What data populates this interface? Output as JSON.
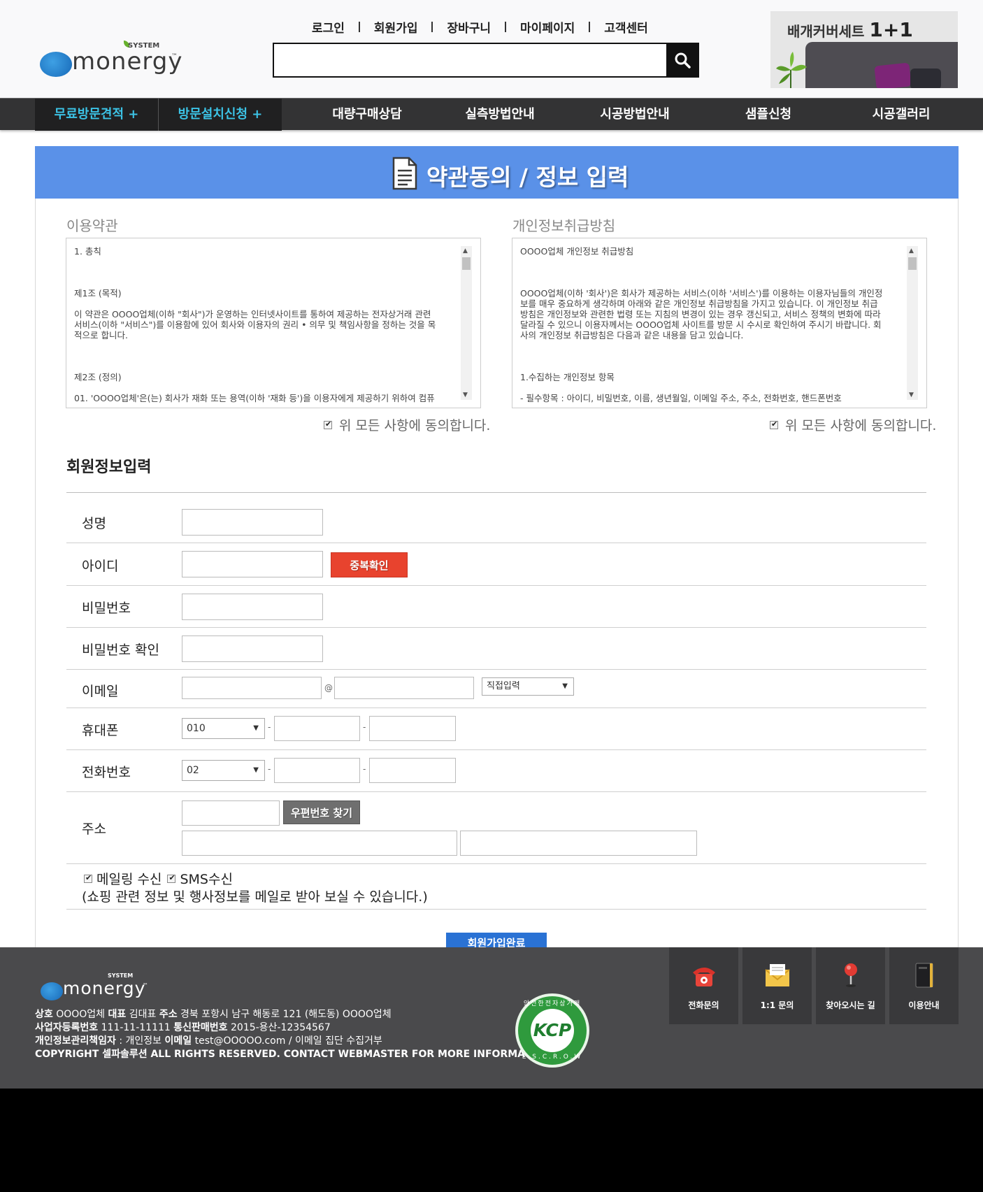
{
  "header": {
    "logo_text": "monergy",
    "logo_system": "SYSTEM",
    "logo_tm": "™",
    "top_links": [
      "로그인",
      "회원가입",
      "장바구니",
      "마이페이지",
      "고객센터"
    ],
    "search_placeholder": "",
    "search_icon": "search-icon",
    "banner": {
      "text": "배개커버세트",
      "highlight": "1+1"
    }
  },
  "main_nav": [
    "무료방문견적 +",
    "방문설치신청 +",
    "대량구매상담",
    "실측방법안내",
    "시공방법안내",
    "샘플신청",
    "시공갤러리"
  ],
  "page_title": "약관동의 / 정보 입력",
  "terms": {
    "label": "이용약관",
    "text": "1. 총칙\n\n\n\n제1조 (목적)\n\n이 약관은 OOOO업체(이하 \"회사\")가 운영하는 인터넷사이트를 통하여 제공하는 전자상거래 관련\n서비스(이하 \"서비스\")를 이용함에 있어 회사와 이용자의 권리 • 의무 및 책임사항을 정하는 것을 목\n적으로 합니다.\n\n\n\n제2조 (정의)\n\n01. 'OOOO업체'은(는) 회사가 재화 또는 용역(이하 '재화 등')을 이용자에게 제공하기 위하여 컴퓨",
    "agree_label": "위 모든 사항에 동의합니다."
  },
  "privacy": {
    "label": "개인정보취급방침",
    "text": "OOOO업체 개인정보 취급방침\n\n\n\nOOOO업체(이하 '회사')은 회사가 제공하는 서비스(이하 '서비스')를 이용하는 이용자님들의 개인정\n보를 매우 중요하게 생각하며 아래와 같은 개인정보 취급방침을 가지고 있습니다. 이 개인정보 취급\n방침은 개인정보와 관련한 법령 또는 지침의 변경이 있는 경우 갱신되고, 서비스 정책의 변화에 따라\n달라질 수 있으니 이용자께서는 OOOO업체 사이트를 방문 시 수시로 확인하여 주시기 바랍니다. 회\n사의 개인정보 취급방침은 다음과 같은 내용을 담고 있습니다.\n\n\n\n1.수집하는 개인정보 항목\n\n- 필수항목 : 아이디, 비밀번호, 이름, 생년월일, 이메일 주소, 주소, 전화번호, 핸드폰번호",
    "agree_label": "위 모든 사항에 동의합니다."
  },
  "form": {
    "section_title": "회원정보입력",
    "name_label": "성명",
    "id_label": "아이디",
    "id_check_button": "중복확인",
    "password_label": "비밀번호",
    "password_confirm_label": "비밀번호 확인",
    "email_label": "이메일",
    "email_at": "@",
    "email_domain_select": "직접입력",
    "mobile_label": "휴대폰",
    "mobile_prefix": "010",
    "phone_label": "전화번호",
    "phone_prefix": "02",
    "dash": "-",
    "address_label": "주소",
    "zipcode_button": "우편번호 찾기",
    "mailing_label": "메일링 수신",
    "sms_label": "SMS수신",
    "mailing_note": "(쇼핑 관련 정보 및 행사정보를 메일로 받아 보실 수 있습니다.)",
    "submit_label": "회원가입완료"
  },
  "footer": {
    "logo_text": "monergy",
    "logo_system": "SYSTEM",
    "logo_tm": "™",
    "line1": {
      "k1": "상호",
      "v1": "OOOO업체",
      "k2": "대표",
      "v2": "김대표",
      "k3": "주소",
      "v3": "경북 포항시 남구 해동로 121 (해도동) OOOO업체"
    },
    "line2": {
      "k1": "사업자등록번호",
      "v1": "111-11-11111",
      "k2": "통신판매번호",
      "v2": "2015-용산-12354567"
    },
    "line3": {
      "k1": "개인정보관리책임자",
      "v1": ": 개인정보",
      "k2": "이메일",
      "v2": "test@OOOOO.com / 이메일 집단 수집거부"
    },
    "copyright": "COPYRIGHT 셀파솔루션 ALL RIGHTS RESERVED. CONTACT WEBMASTER FOR MORE INFORMATION.",
    "kcp": {
      "text": "KCP",
      "top": "안전한전자상거래",
      "bottom": "E.S.C.R.O.W"
    },
    "quick_links": [
      {
        "label": "전화문의",
        "icon": "phone-icon"
      },
      {
        "label": "1:1 문의",
        "icon": "envelope-icon"
      },
      {
        "label": "찾아오시는 길",
        "icon": "map-pin-icon"
      },
      {
        "label": "이용안내",
        "icon": "book-icon"
      }
    ]
  },
  "colors": {
    "title_bar": "#5a91e8",
    "nav_bg": "#333334",
    "nav_highlight": "#3cc3e6",
    "red_button": "#e8432e",
    "submit_button": "#2a72d4",
    "footer_bg": "#4a4a4c"
  }
}
